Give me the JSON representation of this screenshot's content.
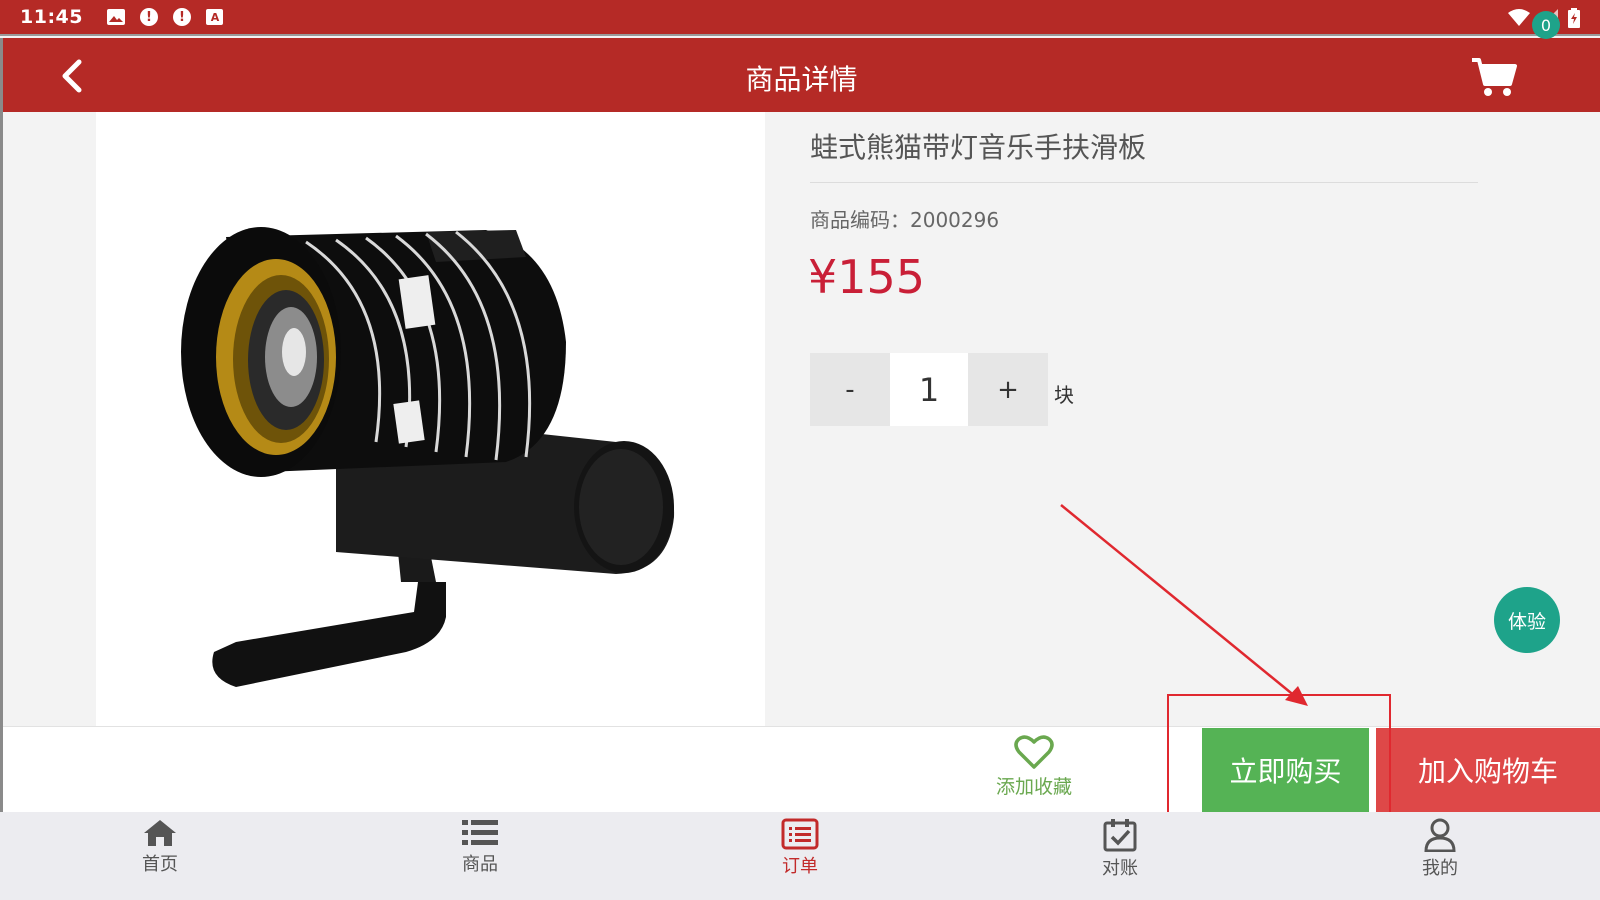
{
  "status_bar": {
    "time": "11:45",
    "icons": [
      "image-icon",
      "alert-icon",
      "alert-icon",
      "text-icon"
    ],
    "right_icons": [
      "wifi-icon",
      "signal-icon",
      "battery-icon"
    ]
  },
  "header": {
    "title": "商品详情",
    "cart_count": "0"
  },
  "product": {
    "name": "蛙式熊猫带灯音乐手扶滑板",
    "code_label": "商品编码：",
    "code": "2000296",
    "price": "¥155",
    "quantity": "1",
    "qty_minus": "-",
    "qty_plus": "+",
    "unit": "块"
  },
  "float_badge": "体验",
  "actions": {
    "favorite": "添加收藏",
    "buy_now": "立即购买",
    "add_to_cart": "加入购物车"
  },
  "bottom_nav": [
    {
      "label": "首页",
      "icon": "home-icon",
      "active": false
    },
    {
      "label": "商品",
      "icon": "list-icon",
      "active": false
    },
    {
      "label": "订单",
      "icon": "order-icon",
      "active": true
    },
    {
      "label": "对账",
      "icon": "calendar-check-icon",
      "active": false
    },
    {
      "label": "我的",
      "icon": "user-icon",
      "active": false
    }
  ],
  "colors": {
    "brand_red": "#b52a26",
    "price_red": "#c91f37",
    "buy_green": "#55b355",
    "cart_red": "#de4848",
    "teal": "#1ea38a",
    "annotation_red": "#e0282f"
  }
}
